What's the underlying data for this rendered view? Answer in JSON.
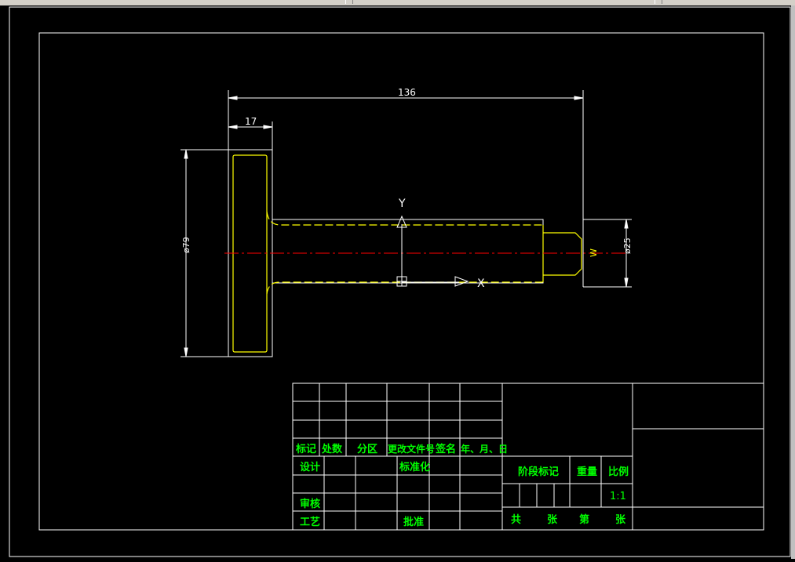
{
  "dimensions": {
    "length": "136",
    "flange_thickness": "17",
    "flange_diameter": "ø79",
    "shaft_diameter": "ø25"
  },
  "axes": {
    "y_label": "Y",
    "x_label": "X",
    "w_label": "W"
  },
  "title_block": {
    "header_row": [
      "标记",
      "处数",
      "分区",
      "更改文件号",
      "签名",
      "年、月、日"
    ],
    "design": "设计",
    "standardize": "标准化",
    "review": "审核",
    "process": "工艺",
    "approve": "批准",
    "stage_mark": "阶段标记",
    "weight": "重量",
    "scale": "比例",
    "scale_value": "1:1",
    "total": "共",
    "sheets1": "张",
    "sheet_no": "第",
    "sheets2": "张"
  },
  "colors": {
    "background": "#000000",
    "frame": "#ffffff",
    "part_outline": "#ffff00",
    "center_line": "#ff0000",
    "table_text": "#00ff00",
    "dimension": "#ffffff"
  }
}
